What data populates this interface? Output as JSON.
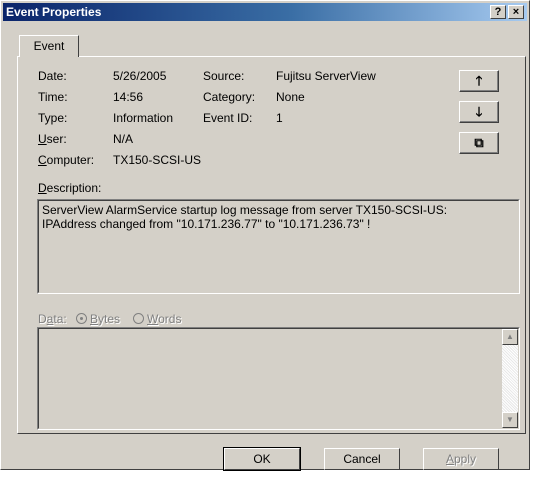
{
  "window": {
    "title": "Event Properties",
    "help_label": "?",
    "close_label": "×"
  },
  "tab": {
    "label": "Event"
  },
  "fields": {
    "date_label": "Date:",
    "date_value": "5/26/2005",
    "time_label": "Time:",
    "time_value": "14:56",
    "type_label": "Type:",
    "type_value": "Information",
    "user_label_first": "U",
    "user_label_rest": "ser:",
    "user_value": "N/A",
    "computer_label_first": "C",
    "computer_label_rest": "omputer:",
    "computer_value": "TX150-SCSI-US",
    "source_label": "Source:",
    "source_value": "Fujitsu ServerView",
    "category_label": "Category:",
    "category_value": "None",
    "eventid_label": "Event ID:",
    "eventid_value": "1"
  },
  "side_buttons": {
    "up": "🡑",
    "down": "🡓",
    "copy": "⧉"
  },
  "description": {
    "label_first": "D",
    "label_rest": "escription:",
    "text": "ServerView AlarmService startup log message from server TX150-SCSI-US:\nIPAddress changed from \"10.171.236.77\" to \"10.171.236.73\" !"
  },
  "data_section": {
    "label_first": "D",
    "label_mid": "a",
    "label_rest": "ta:",
    "bytes_first": "B",
    "bytes_rest": "ytes",
    "words_first": "W",
    "words_rest": "ords",
    "selected": "Bytes"
  },
  "buttons": {
    "ok": "OK",
    "cancel": "Cancel",
    "apply_first": "A",
    "apply_rest": "pply"
  }
}
